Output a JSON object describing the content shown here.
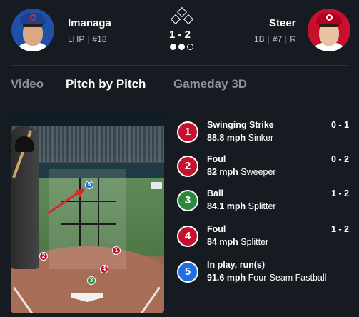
{
  "pitcher": {
    "name": "Imanaga",
    "throws": "LHP",
    "number": "#18"
  },
  "batter": {
    "name": "Steer",
    "position": "1B",
    "number": "#7",
    "bats": "R"
  },
  "situation": {
    "count": "1 - 2",
    "outs_shown": 2,
    "outs_total": 3
  },
  "tabs": [
    {
      "label": "Video",
      "active": false
    },
    {
      "label": "Pitch by Pitch",
      "active": true
    },
    {
      "label": "Gameday 3D",
      "active": false
    }
  ],
  "pitches": [
    {
      "num": "1",
      "result": "Swinging Strike",
      "count": "0 - 1",
      "speed": "88.8 mph",
      "type": "Sinker",
      "color": "#c8102e"
    },
    {
      "num": "2",
      "result": "Foul",
      "count": "0 - 2",
      "speed": "82 mph",
      "type": "Sweeper",
      "color": "#c8102e"
    },
    {
      "num": "3",
      "result": "Ball",
      "count": "1 - 2",
      "speed": "84.1 mph",
      "type": "Splitter",
      "color": "#2a8a3c"
    },
    {
      "num": "4",
      "result": "Foul",
      "count": "1 - 2",
      "speed": "84 mph",
      "type": "Splitter",
      "color": "#c8102e"
    },
    {
      "num": "5",
      "result": "In play, run(s)",
      "count": "",
      "speed": "91.6 mph",
      "type": "Four-Seam Fastball",
      "color": "#1f6fe0"
    }
  ],
  "zone_markers": [
    "1",
    "2",
    "3",
    "4",
    "5"
  ],
  "icons": {
    "bases": "diamond-bases-icon",
    "outs": "out-dots-icon",
    "arrow": "red-pointer-arrow"
  }
}
